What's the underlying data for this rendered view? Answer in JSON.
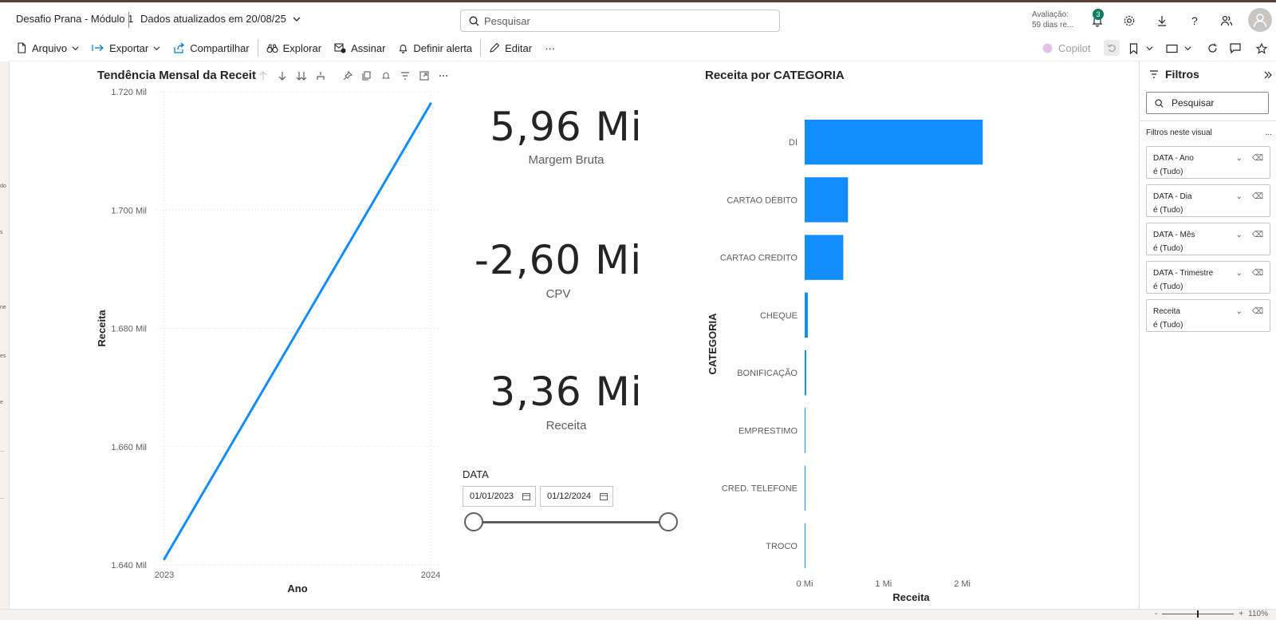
{
  "header": {
    "app_title": "Desafio Prana - Módulo 1",
    "updated_label": "Dados atualizados em 20/08/25",
    "search_placeholder": "Pesquisar",
    "trial_line1": "Avaliação:",
    "trial_line2": "59 dias re...",
    "notification_count": "3"
  },
  "ribbon": {
    "arquivo": "Arquivo",
    "exportar": "Exportar",
    "compartilhar": "Compartilhar",
    "explorar": "Explorar",
    "assinar": "Assinar",
    "definir_alerta": "Definir alerta",
    "editar": "Editar",
    "more": "···",
    "copilot": "Copilot"
  },
  "left_edge": [
    "do",
    "s",
    "ne",
    "es",
    "e",
    "...",
    "..."
  ],
  "line_chart": {
    "title": "Tendência Mensal da Receit",
    "chart_data": {
      "type": "line",
      "x": [
        "2023",
        "2024"
      ],
      "series": [
        {
          "values": [
            1641,
            1718
          ]
        }
      ],
      "xlabel": "Ano",
      "ylabel": "Receita",
      "ylim": [
        1640,
        1720
      ],
      "y_ticks": [
        "1.640 Mil",
        "1.660 Mil",
        "1.680 Mil",
        "1.700 Mil",
        "1.720 Mil"
      ],
      "x_ticks": [
        "2023",
        "2024"
      ],
      "grid": true,
      "color": "#118DFF"
    }
  },
  "cards": [
    {
      "value": "5,96 Mi",
      "label": "Margem Bruta"
    },
    {
      "value": "-2,60 Mi",
      "label": "CPV"
    },
    {
      "value": "3,36 Mi",
      "label": "Receita"
    }
  ],
  "slicer": {
    "title": "DATA",
    "start": "01/01/2023",
    "end": "01/12/2024",
    "range_fraction": [
      0,
      1
    ]
  },
  "bar_chart": {
    "title": "Receita por CATEGORIA",
    "chart_data": {
      "type": "bar",
      "orientation": "horizontal",
      "categories": [
        "DI",
        "CARTAO DÉBITO",
        "CARTAO CREDITO",
        "CHEQUE",
        "BONIFICAÇÃO",
        "EMPRESTIMO",
        "CRED. TELEFONE",
        "TROCO"
      ],
      "values": [
        2.26,
        0.55,
        0.49,
        0.04,
        0.02,
        0.005,
        0.005,
        0.003
      ],
      "xlabel": "Receita",
      "ylabel": "CATEGORIA",
      "xlim": [
        0,
        2.5
      ],
      "x_ticks": [
        "0 Mi",
        "1 Mi",
        "2 Mi"
      ],
      "color": "#118DFF"
    }
  },
  "filters": {
    "title": "Filtros",
    "search_placeholder": "Pesquisar",
    "section": "Filtros neste visual",
    "section_more": "...",
    "items": [
      {
        "name": "DATA - Ano",
        "state": "é (Tudo)"
      },
      {
        "name": "DATA - Dia",
        "state": "é (Tudo)"
      },
      {
        "name": "DATA - Mês",
        "state": "é (Tudo)"
      },
      {
        "name": "DATA - Trimestre",
        "state": "é (Tudo)"
      },
      {
        "name": "Receita",
        "state": "é (Tudo)"
      }
    ]
  },
  "status": {
    "zoom": "110%"
  }
}
